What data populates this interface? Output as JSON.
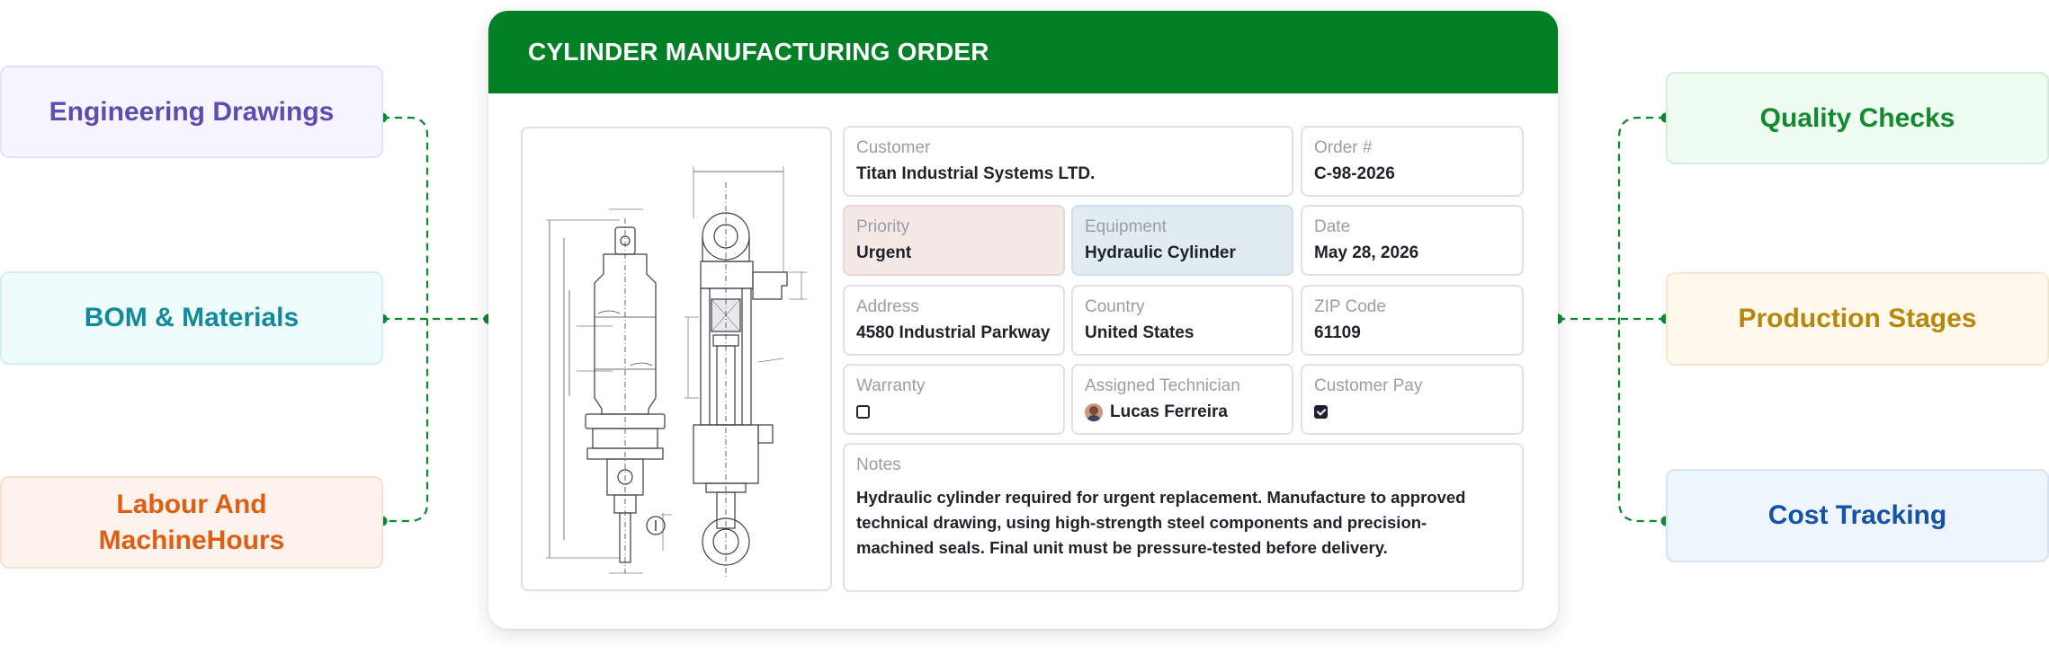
{
  "order": {
    "title": "CYLINDER MANUFACTURING ORDER",
    "customer": {
      "label": "Customer",
      "value": "Titan Industrial Systems LTD."
    },
    "order_number": {
      "label": "Order #",
      "value": "C-98-2026"
    },
    "priority": {
      "label": "Priority",
      "value": "Urgent"
    },
    "equipment": {
      "label": "Equipment",
      "value": "Hydraulic Cylinder"
    },
    "date": {
      "label": "Date",
      "value": "May 28, 2026"
    },
    "address": {
      "label": "Address",
      "value": "4580 Industrial Parkway"
    },
    "country": {
      "label": "Country",
      "value": "United States"
    },
    "zip": {
      "label": "ZIP Code",
      "value": "61109"
    },
    "warranty": {
      "label": "Warranty",
      "checked": false
    },
    "technician": {
      "label": "Assigned Technician",
      "value": "Lucas Ferreira"
    },
    "customer_pay": {
      "label": "Customer Pay",
      "checked": true
    },
    "notes": {
      "label": "Notes",
      "value": "Hydraulic cylinder required for urgent replacement. Manufacture to approved technical drawing, using high-strength steel components and precision-machined seals. Final unit must be pressure-tested before delivery."
    }
  },
  "left_modules": [
    {
      "label": "Engineering Drawings",
      "color": "#5f4bb3",
      "bg": "#f6f5fe"
    },
    {
      "label": "BOM & Materials",
      "color": "#118a9c",
      "bg": "#effcfe"
    },
    {
      "label_line1": "Labour And",
      "label_line2": "MachineHours",
      "color": "#e05d14",
      "bg": "#fdf3ec"
    }
  ],
  "right_modules": [
    {
      "label": "Quality Checks",
      "color": "#148a2e",
      "bg": "#effcf1"
    },
    {
      "label": "Production Stages",
      "color": "#b8860b",
      "bg": "#fef9ec"
    },
    {
      "label": "Cost Tracking",
      "color": "#1451a8",
      "bg": "#eff5fd"
    }
  ],
  "colors": {
    "header": "#038026",
    "connector": "#0a8a2e",
    "priority_bg": "#f5e9e8",
    "equipment_bg": "#e1ebf2"
  },
  "drawing": {
    "description_icon": "technical-drawing-icon"
  }
}
